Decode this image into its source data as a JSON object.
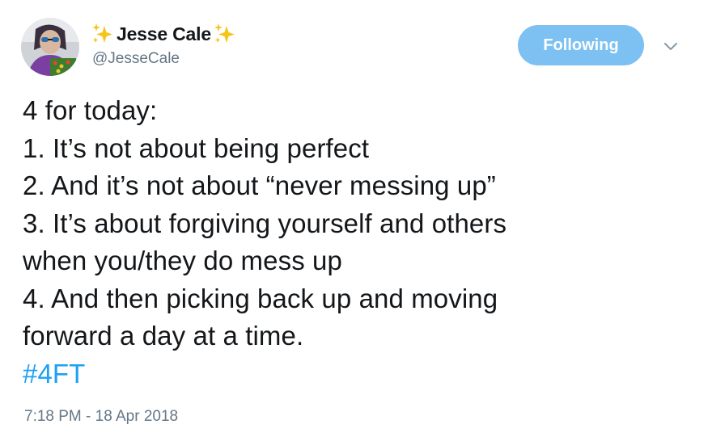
{
  "author": {
    "display_name": "Jesse Cale",
    "handle": "@JesseCale"
  },
  "follow_button": {
    "label": "Following"
  },
  "tweet": {
    "lines": [
      "4 for today:",
      "1. It’s not about being perfect",
      "2. And it’s not about “never messing up”",
      "3. It’s about forgiving yourself and others",
      "when you/they do mess up",
      "4. And then picking back up and moving",
      "forward a day at a time."
    ],
    "hashtag": "#4FT",
    "timestamp": "7:18 PM - 18 Apr 2018"
  },
  "colors": {
    "accent": "#1da1f2",
    "follow_button_bg": "#7cc1f2",
    "secondary_text": "#657786",
    "primary_text": "#14171a",
    "sparkle": "#f5c518"
  },
  "icons": {
    "avatar": "profile-photo",
    "sparkle_left": "sparkles-emoji",
    "sparkle_right": "sparkles-emoji",
    "menu": "chevron-down-icon"
  }
}
